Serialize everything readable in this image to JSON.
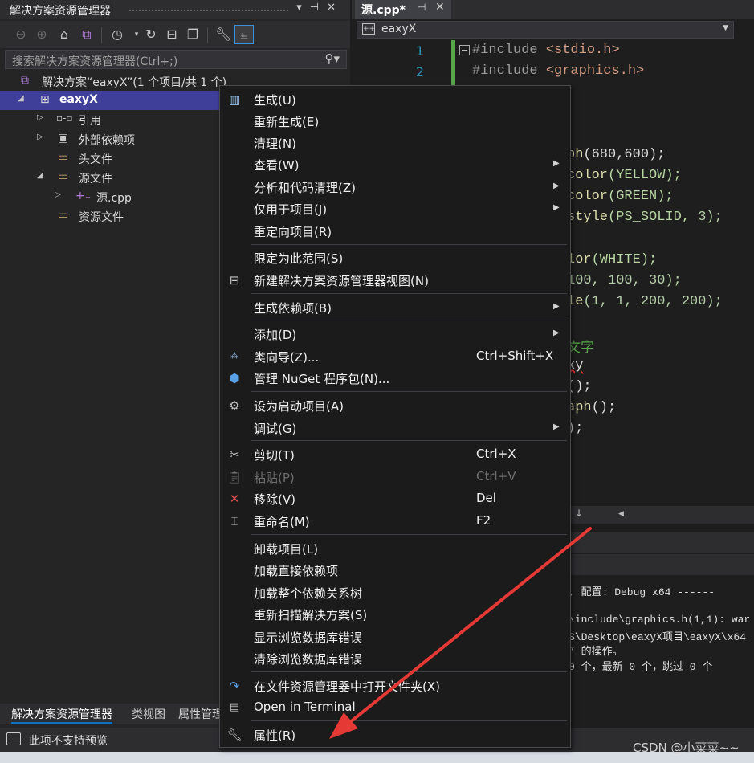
{
  "solution_explorer": {
    "title": "解决方案资源管理器",
    "title_buttons": [
      "▾",
      "⊣",
      "✕"
    ],
    "search_placeholder": "搜索解决方案资源管理器(Ctrl+;)",
    "tree": {
      "solution": "解决方案“eaxyX”(1 个项目/共 1 个)",
      "project": "eaxyX",
      "references": "引用",
      "external_deps": "外部依赖项",
      "header_files": "头文件",
      "source_files": "源文件",
      "source_cpp": "源.cpp",
      "resource_files": "资源文件"
    },
    "bottom_tabs": [
      "解决方案资源管理器",
      "类视图",
      "属性管理器"
    ]
  },
  "status_bar": {
    "text": "此项不支持预览"
  },
  "editor": {
    "tab": {
      "name": "源.cpp*",
      "pin": "⊣",
      "close": "✕"
    },
    "nav_dropdown": "eaxyX",
    "nav_icon": "++",
    "line_numbers": [
      "1",
      "2"
    ],
    "code": {
      "l1_pp": "#include ",
      "l1_inc": "<stdio.h>",
      "l2_pp": "#include ",
      "l2_inc": "<graphics.h>",
      "l3_fn": "ph",
      "l3_num": "(680,600);",
      "l4_fn": "color",
      "l4_mc": "(YELLOW);",
      "l5_fn": "color",
      "l5_mc": "(GREEN);",
      "l6_fn": "style",
      "l6_mc": "(PS_SOLID, ",
      "l6_num": "3);",
      "l7_fn": "lor",
      "l7_mc": "(WHITE);",
      "l8_num": "100, 100, 30);",
      "l9_fn": "le",
      "l9_num": "(1, 1, 200, 200);",
      "l10_cm": "文字",
      "l11": "xy",
      "l12": "();",
      "l13_fn": "aph",
      "l13": "();",
      "l14": ");"
    },
    "output": [
      ", 配置: Debug x64 ------",
      "\\include\\graphics.h(1,1): war",
      "S\\Desktop\\eaxyX项目\\eaxyX\\x64",
      "” 的操作。",
      "0 个，最新 0 个，跳过 0 个"
    ]
  },
  "context_menu": {
    "items": [
      {
        "label": "生成(U)",
        "icon": "build-icon"
      },
      {
        "label": "重新生成(E)"
      },
      {
        "label": "清理(N)"
      },
      {
        "label": "查看(W)",
        "submenu": true
      },
      {
        "label": "分析和代码清理(Z)",
        "submenu": true
      },
      {
        "label": "仅用于项目(J)",
        "submenu": true
      },
      {
        "label": "重定向项目(R)"
      },
      {
        "label": "限定为此范围(S)"
      },
      {
        "label": "新建解决方案资源管理器视图(N)",
        "icon": "new-view-icon"
      },
      {
        "label": "生成依赖项(B)",
        "submenu": true
      },
      {
        "label": "添加(D)",
        "submenu": true
      },
      {
        "label": "类向导(Z)...",
        "shortcut": "Ctrl+Shift+X",
        "icon": "class-wizard-icon"
      },
      {
        "label": "管理 NuGet 程序包(N)...",
        "icon": "nuget-icon"
      },
      {
        "label": "设为启动项目(A)",
        "icon": "gear-icon"
      },
      {
        "label": "调试(G)",
        "submenu": true
      },
      {
        "label": "剪切(T)",
        "shortcut": "Ctrl+X",
        "icon": "scissors-icon"
      },
      {
        "label": "粘贴(P)",
        "shortcut": "Ctrl+V",
        "icon": "paste-icon",
        "disabled": true
      },
      {
        "label": "移除(V)",
        "shortcut": "Del",
        "icon": "remove-icon"
      },
      {
        "label": "重命名(M)",
        "shortcut": "F2",
        "icon": "rename-icon"
      },
      {
        "label": "卸载项目(L)"
      },
      {
        "label": "加载直接依赖项"
      },
      {
        "label": "加载整个依赖关系树"
      },
      {
        "label": "重新扫描解决方案(S)"
      },
      {
        "label": "显示浏览数据库错误"
      },
      {
        "label": "清除浏览数据库错误"
      },
      {
        "label": "在文件资源管理器中打开文件夹(X)",
        "icon": "open-folder-icon"
      },
      {
        "label": "Open in Terminal",
        "icon": "terminal-icon"
      },
      {
        "label": "属性(R)",
        "icon": "wrench-icon"
      }
    ]
  },
  "watermark": "CSDN @小菜菜~~",
  "colors": {
    "accent": "#3f3f9a",
    "arrow": "#e53935",
    "menu_bg": "#1b1b1c"
  }
}
